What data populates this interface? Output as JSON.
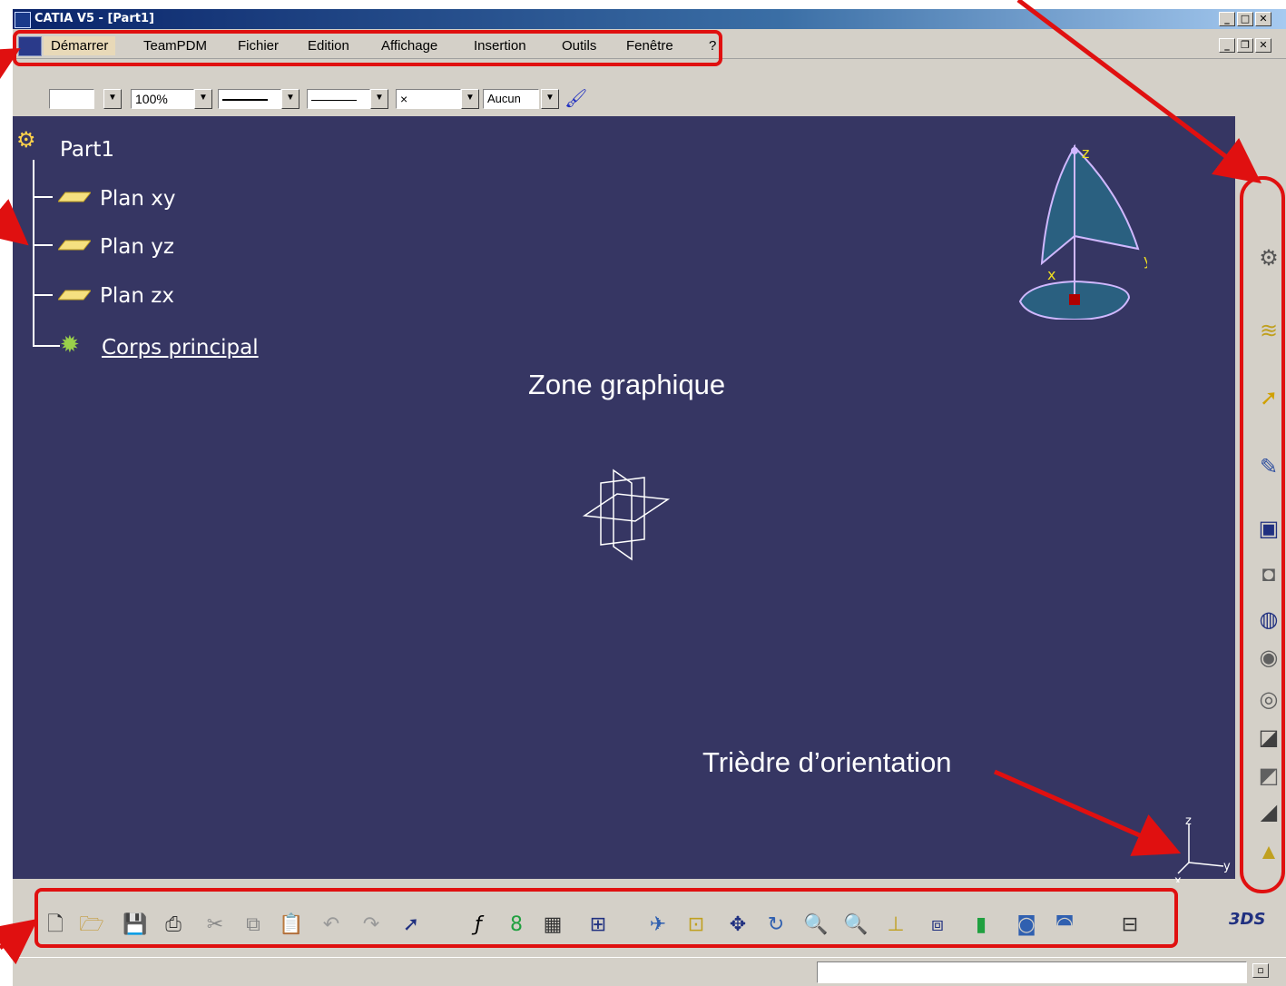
{
  "window": {
    "title": "CATIA V5 - [Part1]"
  },
  "menu": {
    "items": [
      "Démarrer",
      "TeamPDM",
      "Fichier",
      "Edition",
      "Affichage",
      "Insertion",
      "Outils",
      "Fenêtre",
      "?"
    ]
  },
  "toolbar_properties": {
    "zoom_value": "100%",
    "layer_value": "Aucun"
  },
  "tree": {
    "root": "Part1",
    "children": [
      "Plan xy",
      "Plan yz",
      "Plan zx",
      "Corps principal"
    ]
  },
  "graphics": {
    "zone_label": "Zone graphique",
    "triad_label": "Trièdre d’orientation",
    "compass_axes": {
      "x": "x",
      "y": "y",
      "z": "z"
    },
    "triad_axes": {
      "x": "x",
      "y": "y",
      "z": "z"
    }
  },
  "colors": {
    "graphics_bg": "#363663",
    "annotation": "#e01010",
    "ui_face": "#d4d0c8"
  },
  "icons": {
    "right_toolbar": [
      "sketcher-gear-icon",
      "layers-icon",
      "select-arrow-icon",
      "sketch-icon",
      "pad-icon",
      "pocket-icon",
      "shaft-icon",
      "groove-icon",
      "hole-icon",
      "rib-icon",
      "slot-icon",
      "stiffener-icon",
      "loft-icon"
    ],
    "bottom_toolbar": [
      "new-icon",
      "open-icon",
      "save-icon",
      "print-icon",
      "cut-icon",
      "copy-icon",
      "paste-icon",
      "undo-icon",
      "redo-icon",
      "whats-this-icon",
      "formula-icon",
      "knowledge-icon",
      "table-icon",
      "tree-icon",
      "fly-icon",
      "fit-all-icon",
      "pan-icon",
      "rotate-icon",
      "zoom-in-icon",
      "zoom-out-icon",
      "normal-view-icon",
      "iso-view-icon",
      "shading-icon",
      "hide-show-icon",
      "swap-visible-icon",
      "measure-icon"
    ]
  }
}
